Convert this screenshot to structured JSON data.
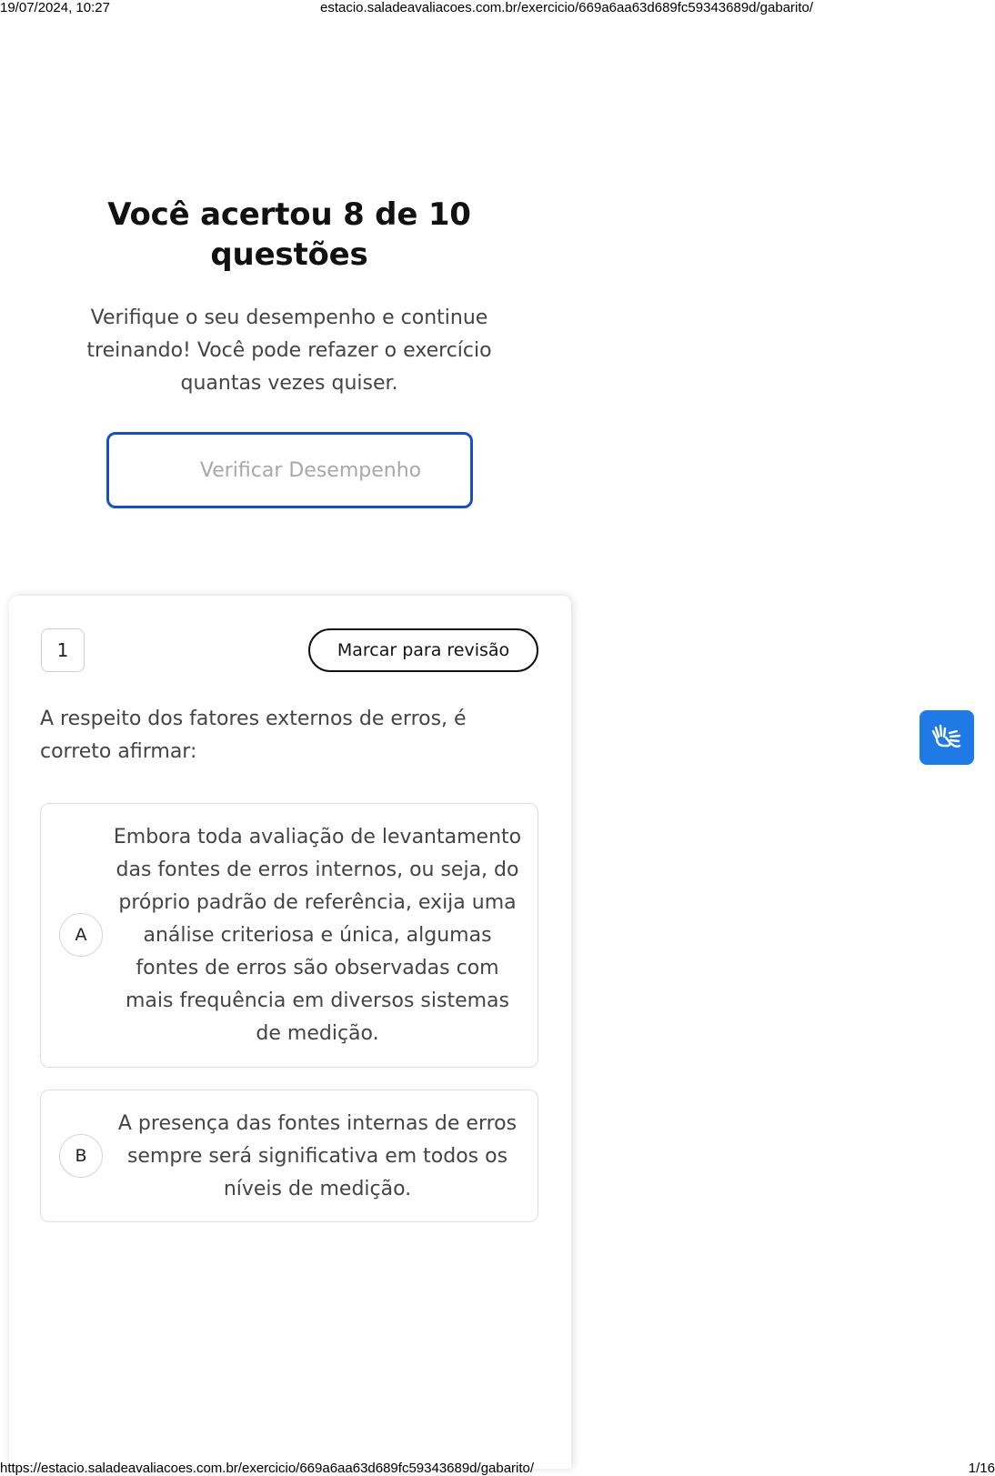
{
  "print_header": {
    "datetime": "19/07/2024, 10:27",
    "url": "estacio.saladeavaliacoes.com.br/exercicio/669a6aa63d689fc59343689d/gabarito/"
  },
  "print_footer": {
    "url": "https://estacio.saladeavaliacoes.com.br/exercicio/669a6aa63d689fc59343689d/gabarito/",
    "page": "1/16"
  },
  "summary": {
    "title": "Você acertou 8 de 10 questões",
    "text": "Verifique o seu desempenho e continue treinando! Você pode refazer o exercício quantas vezes quiser.",
    "button_label": "Verificar Desempenho"
  },
  "question": {
    "number": "1",
    "review_label": "Marcar para revisão",
    "text": "A respeito dos fatores externos de erros, é correto afirmar:",
    "options": [
      {
        "letter": "A",
        "text": "Embora toda avaliação de levantamento das fontes de erros internos, ou seja, do próprio padrão de referência, exija uma análise criteriosa e única, algumas fontes de erros são observadas com mais frequência em diversos sistemas de medição."
      },
      {
        "letter": "B",
        "text": "A presença das fontes internas de erros sempre será significativa em todos os níveis de medição."
      }
    ]
  },
  "accessibility": {
    "icon": "sign-language-icon",
    "color": "#1f7ae6"
  },
  "colors": {
    "primary_border": "#1a4fc4",
    "button_text_disabled": "#a8a8a8"
  }
}
